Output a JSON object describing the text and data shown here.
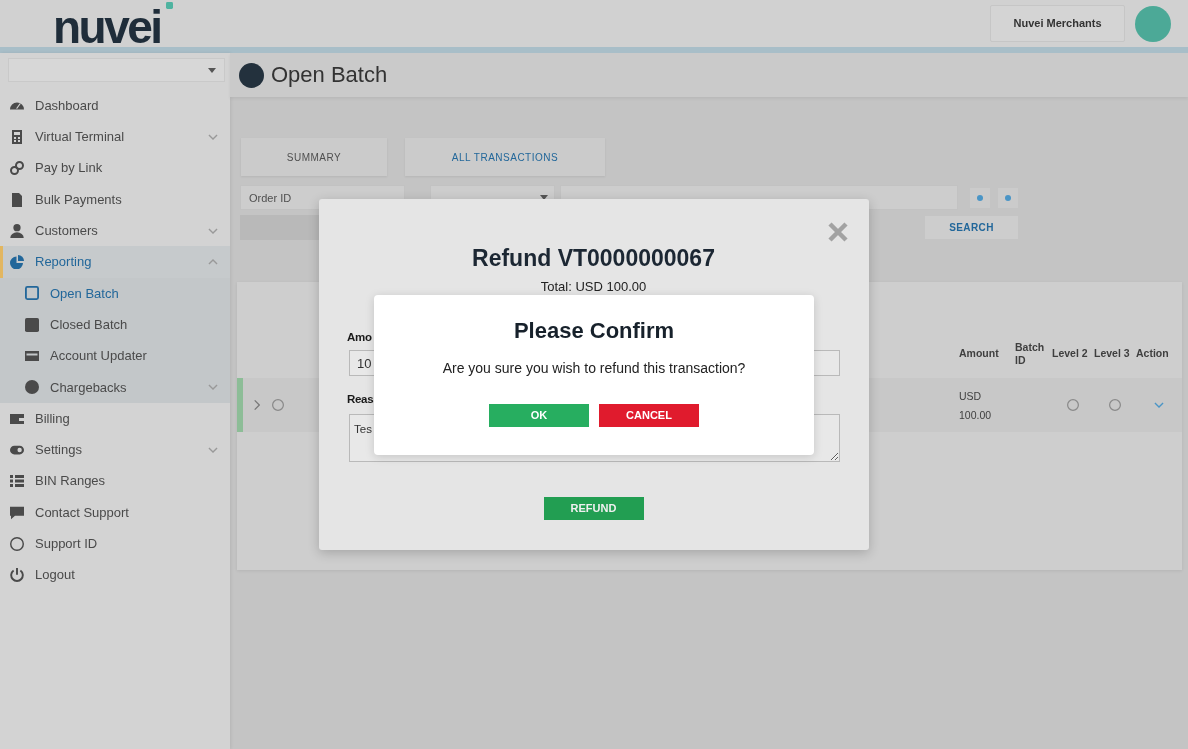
{
  "header": {
    "logo": "nuvei",
    "account_button": "Nuvei Merchants"
  },
  "sidebar": {
    "items": [
      {
        "label": "Dashboard",
        "kind": "link",
        "selected": false
      },
      {
        "label": "Virtual Terminal",
        "kind": "menu",
        "expanded": false,
        "selected": false
      },
      {
        "label": "Pay by Link",
        "kind": "link",
        "selected": false
      },
      {
        "label": "Bulk Payments",
        "kind": "link",
        "selected": false
      },
      {
        "label": "Customers",
        "kind": "menu",
        "expanded": false,
        "selected": false
      },
      {
        "label": "Reporting",
        "kind": "menu",
        "expanded": true,
        "selected": true,
        "children": [
          {
            "label": "Open Batch",
            "kind": "link",
            "selected": true
          },
          {
            "label": "Closed Batch",
            "kind": "link",
            "selected": false
          },
          {
            "label": "Account Updater",
            "kind": "link",
            "selected": false
          },
          {
            "label": "Chargebacks",
            "kind": "menu",
            "expanded": false,
            "selected": false
          }
        ]
      },
      {
        "label": "Billing",
        "kind": "link",
        "selected": false
      },
      {
        "label": "Settings",
        "kind": "menu",
        "expanded": false,
        "selected": false
      },
      {
        "label": "BIN Ranges",
        "kind": "link",
        "selected": false
      },
      {
        "label": "Contact Support",
        "kind": "link",
        "selected": false
      },
      {
        "label": "Support ID",
        "kind": "link",
        "selected": false
      },
      {
        "label": "Logout",
        "kind": "link",
        "selected": false
      }
    ]
  },
  "page": {
    "title": "Open Batch"
  },
  "tabs": [
    {
      "label": "SUMMARY",
      "selected": false
    },
    {
      "label": "ALL TRANSACTIONS",
      "selected": true
    }
  ],
  "filters": {
    "order_id": {
      "placeholder": "Order ID"
    },
    "search_button": "SEARCH"
  },
  "table": {
    "columns": [
      "Amount",
      "Batch ID",
      "Level 2",
      "Level 3",
      "Action"
    ],
    "rows": [
      {
        "amount": "USD 100.00"
      }
    ]
  },
  "refund_dialog": {
    "title": "Refund VT0000000067",
    "total": "Total: USD 100.00",
    "amount_label": "Amo",
    "amount_value": "10",
    "reason_label": "Reas",
    "reason_value": "Tes",
    "refund_button": "REFUND"
  },
  "confirm_dialog": {
    "title": "Please Confirm",
    "message": "Are you sure you wish to refund this transaction?",
    "buttons": [
      {
        "label": "OK",
        "kind": "confirm"
      },
      {
        "label": "CANCEL",
        "kind": "cancel"
      }
    ]
  }
}
